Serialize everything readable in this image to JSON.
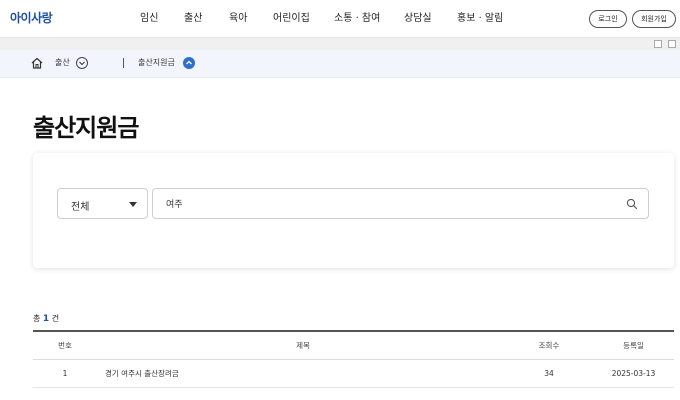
{
  "header": {
    "logo": "아이사랑",
    "nav": [
      "임신",
      "출산",
      "육아",
      "어린이집",
      "소통 · 참여",
      "상담실",
      "홍보 · 알림"
    ],
    "login_label": "로그인",
    "signup_label": "회원가입"
  },
  "breadcrumb": {
    "level1": "출산",
    "level2": "출산지원금"
  },
  "page_title": "출산지원금",
  "search": {
    "select_value": "전체",
    "input_value": "여주",
    "placeholder": ""
  },
  "total": {
    "prefix": "총",
    "count": "1",
    "suffix": "건"
  },
  "table": {
    "headers": {
      "no": "번호",
      "title": "제목",
      "views": "조회수",
      "date": "등록일"
    },
    "rows": [
      {
        "no": "1",
        "title": "경기 여주시 출산장려금",
        "views": "34",
        "date": "2025-03-13"
      }
    ]
  },
  "colors": {
    "brand": "#1e4fa1",
    "breadcrumb_bg": "#f2f6fc",
    "accent_circle": "#2f6fc9"
  }
}
